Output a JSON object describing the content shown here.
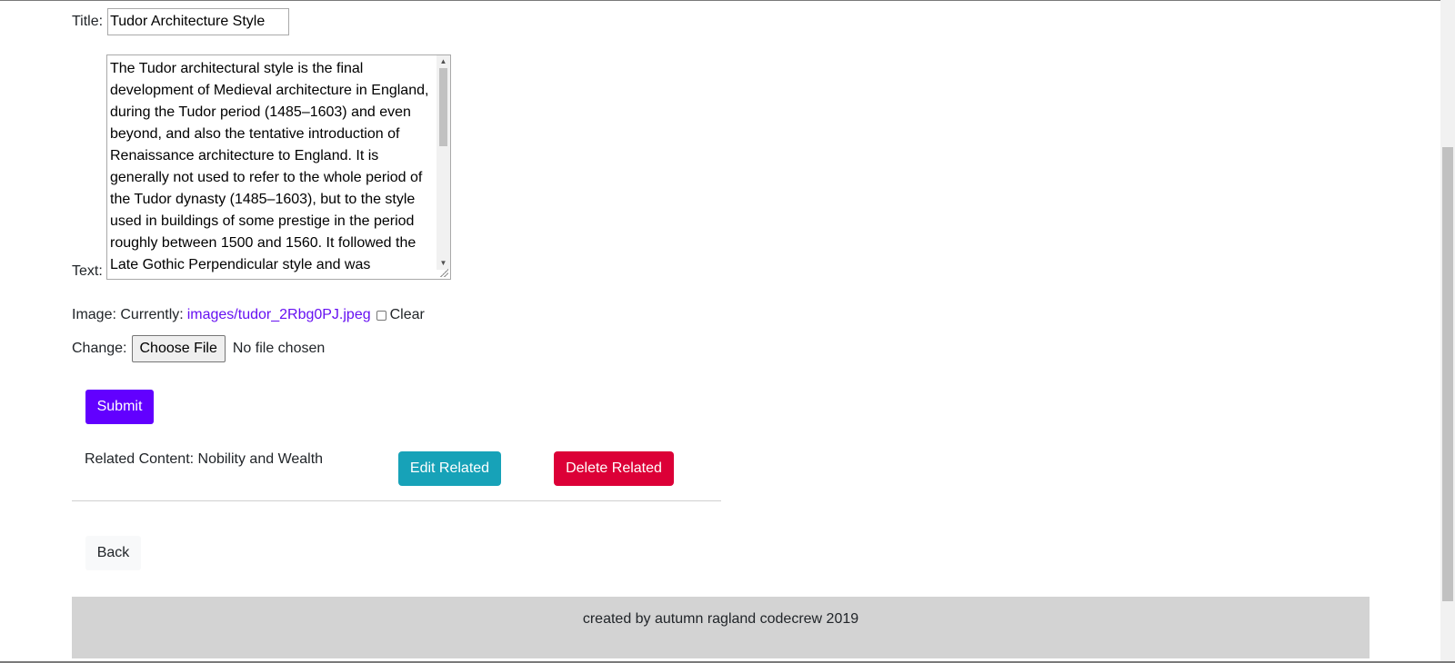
{
  "form": {
    "title_label": "Title:",
    "title_value": "Tudor Architecture Style",
    "text_label": "Text:",
    "text_value": "The Tudor architectural style is the final development of Medieval architecture in England, during the Tudor period (1485–1603) and even beyond, and also the tentative introduction of Renaissance architecture to England. It is generally not used to refer to the whole period of the Tudor dynasty (1485–1603), but to the style used in buildings of some prestige in the period roughly between 1500 and 1560. It followed the Late Gothic Perpendicular style and was",
    "image_label": "Image: Currently:",
    "image_current": "images/tudor_2Rbg0PJ.jpeg",
    "clear_label": "Clear",
    "change_label": "Change:",
    "choose_file_label": "Choose File",
    "no_file_text": "No file chosen",
    "submit_label": "Submit"
  },
  "related": {
    "text": "Related Content: Nobility and Wealth",
    "edit_label": "Edit Related",
    "delete_label": "Delete Related"
  },
  "back_label": "Back",
  "footer": {
    "text": "created by autumn ragland codecrew 2019"
  },
  "colors": {
    "submit": "#6200ff",
    "edit": "#17a2b8",
    "delete": "#dc0037",
    "link": "#6610f2",
    "footer_bg": "#d3d3d3"
  }
}
